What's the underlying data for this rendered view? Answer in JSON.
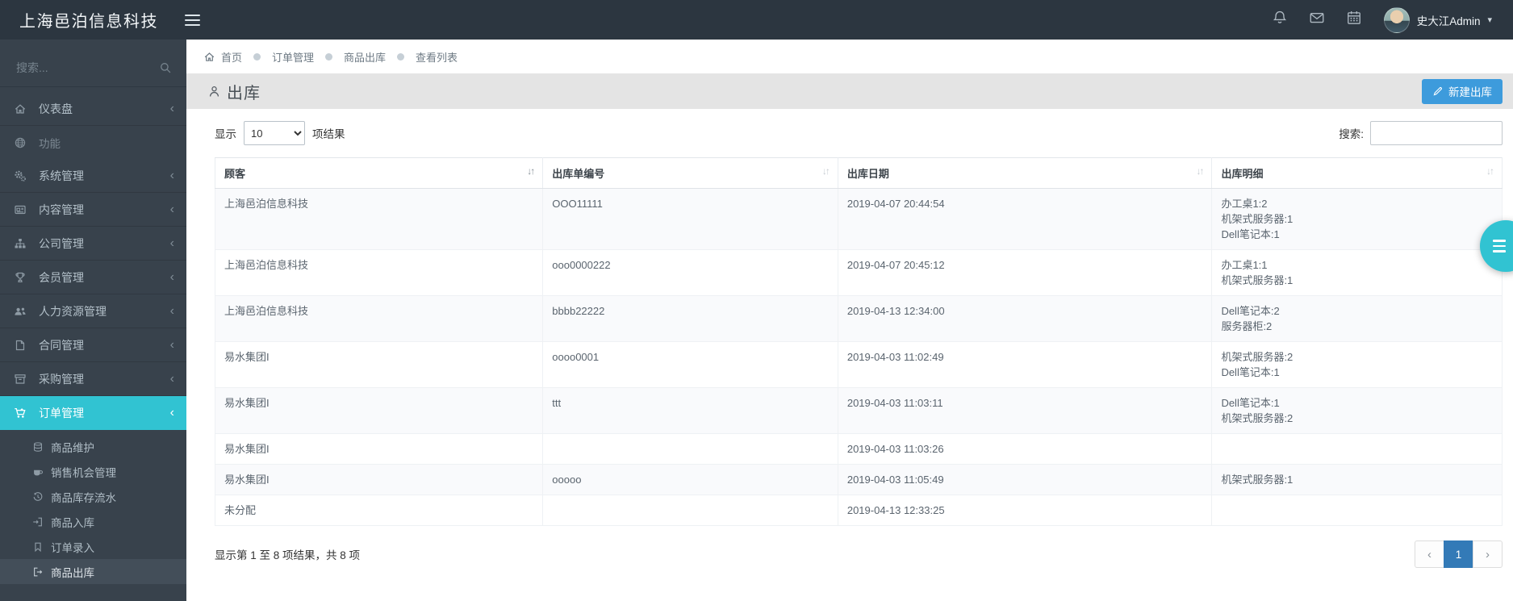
{
  "topbar": {
    "brand": "上海邑泊信息科技",
    "user": "史大江Admin",
    "icons": [
      "hamburger-icon",
      "bell-icon",
      "envelope-icon",
      "calendar-icon",
      "caret-down-icon"
    ]
  },
  "sidebar": {
    "search_placeholder": "搜索...",
    "search_icon": "search-icon",
    "items": [
      {
        "name": "dashboard",
        "label": "仪表盘",
        "icon": "home",
        "chevron": true
      },
      {
        "name": "features",
        "label": "功能",
        "icon": "globe",
        "header": true
      },
      {
        "name": "system-mgmt",
        "label": "系统管理",
        "icon": "gears",
        "chevron": true
      },
      {
        "name": "content-mgmt",
        "label": "内容管理",
        "icon": "newspaper",
        "chevron": true
      },
      {
        "name": "company-mgmt",
        "label": "公司管理",
        "icon": "sitemap",
        "chevron": true
      },
      {
        "name": "member-mgmt",
        "label": "会员管理",
        "icon": "trophy",
        "chevron": true
      },
      {
        "name": "hr-mgmt",
        "label": "人力资源管理",
        "icon": "users",
        "chevron": true
      },
      {
        "name": "contract-mgmt",
        "label": "合同管理",
        "icon": "file",
        "chevron": true
      },
      {
        "name": "purchase-mgmt",
        "label": "采购管理",
        "icon": "archive",
        "chevron": true
      },
      {
        "name": "order-mgmt",
        "label": "订单管理",
        "icon": "cart",
        "chevron": true,
        "active": true
      }
    ],
    "submenu": [
      {
        "name": "product-maintenance",
        "label": "商品维护",
        "icon": "database"
      },
      {
        "name": "sales-opportunity",
        "label": "销售机会管理",
        "icon": "coffee"
      },
      {
        "name": "inventory-flow",
        "label": "商品库存流水",
        "icon": "history"
      },
      {
        "name": "product-inbound",
        "label": "商品入库",
        "icon": "signin"
      },
      {
        "name": "order-entry",
        "label": "订单录入",
        "icon": "bookmark"
      },
      {
        "name": "product-outbound",
        "label": "商品出库",
        "icon": "signout",
        "active": true
      }
    ]
  },
  "breadcrumb": {
    "items": [
      "首页",
      "订单管理",
      "商品出库",
      "查看列表"
    ]
  },
  "page": {
    "title": "出库",
    "title_icon": "user-icon",
    "new_button": "新建出库",
    "new_button_icon": "pencil-icon"
  },
  "controls": {
    "show_label": "显示",
    "page_size": "10",
    "results_label": "项结果",
    "search_label": "搜索:",
    "search_value": ""
  },
  "table": {
    "columns": [
      "顾客",
      "出库单编号",
      "出库日期",
      "出库明细"
    ],
    "sorted_column_index": 0,
    "rows": [
      {
        "customer": "上海邑泊信息科技",
        "order_no": "OOO11111",
        "date": "2019-04-07 20:44:54",
        "details": [
          "办工桌1:2",
          "机架式服务器:1",
          "Dell笔记本:1"
        ]
      },
      {
        "customer": "上海邑泊信息科技",
        "order_no": "ooo0000222",
        "date": "2019-04-07 20:45:12",
        "details": [
          "办工桌1:1",
          "机架式服务器:1"
        ]
      },
      {
        "customer": "上海邑泊信息科技",
        "order_no": "bbbb22222",
        "date": "2019-04-13 12:34:00",
        "details": [
          "Dell笔记本:2",
          "服务器柜:2"
        ]
      },
      {
        "customer": "易水集团I",
        "order_no": "oooo0001",
        "date": "2019-04-03 11:02:49",
        "details": [
          "机架式服务器:2",
          "Dell笔记本:1"
        ]
      },
      {
        "customer": "易水集团I",
        "order_no": "ttt",
        "date": "2019-04-03 11:03:11",
        "details": [
          "Dell笔记本:1",
          "机架式服务器:2"
        ]
      },
      {
        "customer": "易水集团I",
        "order_no": "",
        "date": "2019-04-03 11:03:26",
        "details": []
      },
      {
        "customer": "易水集团I",
        "order_no": "ooooo",
        "date": "2019-04-03 11:05:49",
        "details": [
          "机架式服务器:1"
        ]
      },
      {
        "customer": "未分配",
        "order_no": "",
        "date": "2019-04-13 12:33:25",
        "details": []
      }
    ]
  },
  "footer": {
    "info": "显示第 1 至 8 项结果，共 8 项",
    "page": "1"
  },
  "colors": {
    "accent_teal": "#31c3d2",
    "button_blue": "#3d9bdc",
    "pagination_active_blue": "#337ab7",
    "topbar_bg": "#2c3640",
    "sidebar_bg": "#38424c",
    "header_bar_bg": "#e4e4e4",
    "row_stripe": "#f9fafc"
  }
}
